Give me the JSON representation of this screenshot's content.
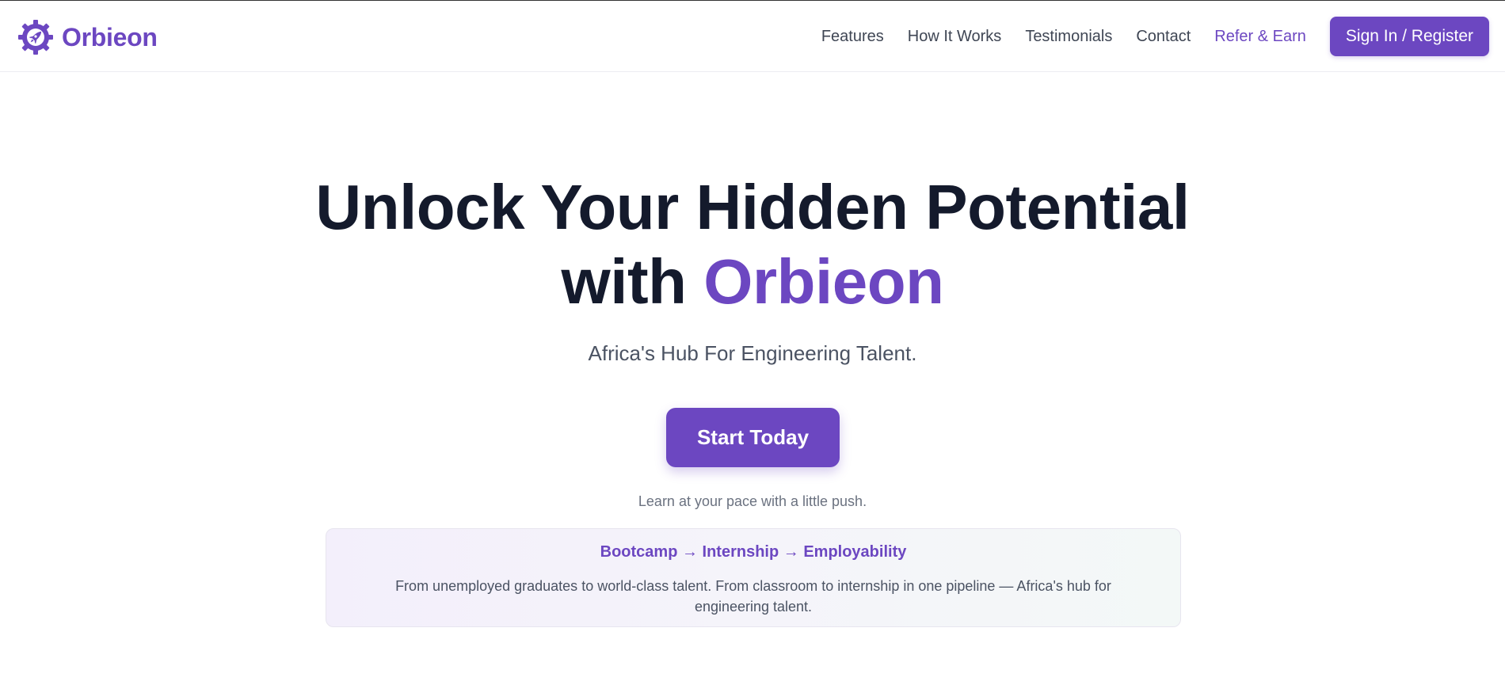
{
  "brand": {
    "name": "Orbieon",
    "logo_icon": "rocket-gear-icon",
    "accent_color": "#6c47c1"
  },
  "nav": {
    "items": [
      {
        "label": "Features"
      },
      {
        "label": "How It Works"
      },
      {
        "label": "Testimonials"
      },
      {
        "label": "Contact"
      },
      {
        "label": "Refer & Earn"
      }
    ],
    "signin_label": "Sign In / Register"
  },
  "hero": {
    "title_line1": "Unlock Your Hidden Potential",
    "title_with": "with",
    "title_brand": "Orbieon",
    "subtitle": "Africa's Hub For Engineering Talent.",
    "cta_label": "Start Today",
    "tagline": "Learn at your pace with a little push."
  },
  "pipeline_card": {
    "title": "Bootcamp → Internship → Employability",
    "text": "From unemployed graduates to world-class talent. From classroom to internship in one pipeline — Africa's hub for engineering talent."
  },
  "colors": {
    "heading": "#141a2c",
    "body_text": "#4b5363",
    "muted_text": "#6b7280",
    "accent": "#6c47c1"
  }
}
